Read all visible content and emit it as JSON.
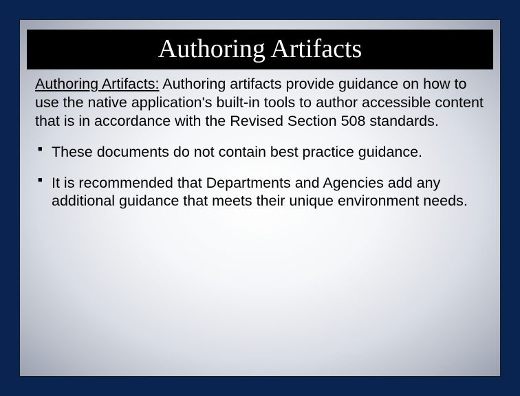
{
  "slide": {
    "title": "Authoring Artifacts",
    "intro_label": "Authoring Artifacts:",
    "intro_text": " Authoring artifacts provide guidance on how to use the native application's built-in tools to author accessible content that is in accordance with the Revised Section 508 standards.",
    "bullets": [
      "These documents do not contain best practice guidance.",
      "It is recommended that Departments and Agencies add any additional guidance that meets their unique environment needs."
    ]
  }
}
